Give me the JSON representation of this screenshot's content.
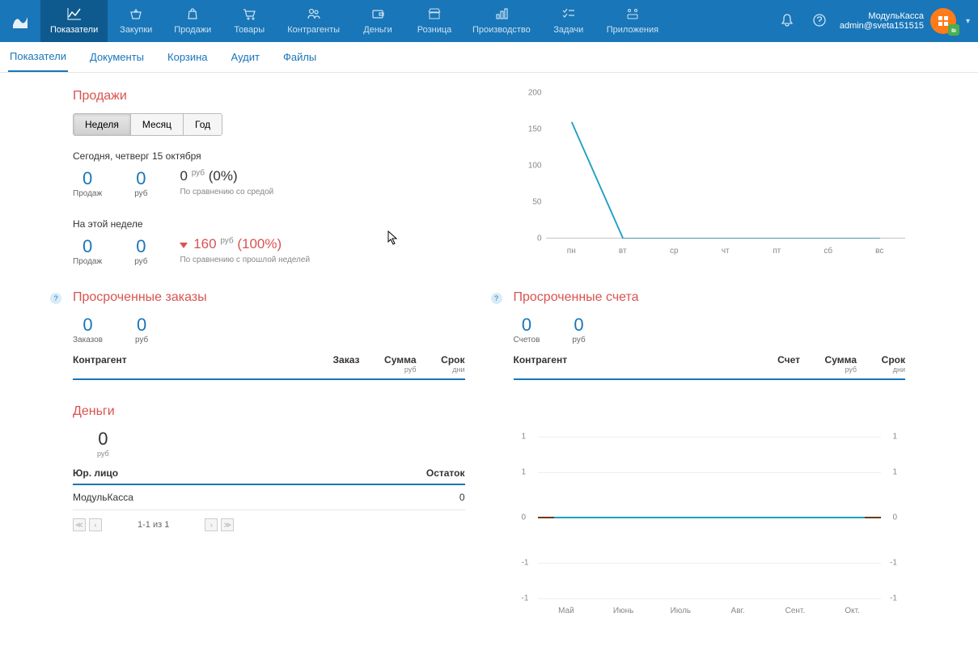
{
  "nav": {
    "items": [
      {
        "label": "Показатели"
      },
      {
        "label": "Закупки"
      },
      {
        "label": "Продажи"
      },
      {
        "label": "Товары"
      },
      {
        "label": "Контрагенты"
      },
      {
        "label": "Деньги"
      },
      {
        "label": "Розница"
      },
      {
        "label": "Производство"
      },
      {
        "label": "Задачи"
      },
      {
        "label": "Приложения"
      }
    ]
  },
  "user": {
    "title": "МодульКасса",
    "login": "admin@sveta151515"
  },
  "subnav": {
    "items": [
      {
        "label": "Показатели"
      },
      {
        "label": "Документы"
      },
      {
        "label": "Корзина"
      },
      {
        "label": "Аудит"
      },
      {
        "label": "Файлы"
      }
    ]
  },
  "sales": {
    "title": "Продажи",
    "periods": [
      {
        "label": "Неделя"
      },
      {
        "label": "Месяц"
      },
      {
        "label": "Год"
      }
    ],
    "today_label": "Сегодня, четверг 15 октября",
    "today": {
      "sales_count": "0",
      "sales_caption": "Продаж",
      "rub_value": "0",
      "rub_caption": "руб",
      "compare_value": "0",
      "compare_unit": "руб",
      "compare_pct": "(0%)",
      "compare_sub": "По сравнению со средой"
    },
    "week_label": "На этой неделе",
    "week": {
      "sales_count": "0",
      "sales_caption": "Продаж",
      "rub_value": "0",
      "rub_caption": "руб",
      "compare_value": "160",
      "compare_unit": "руб",
      "compare_pct": "(100%)",
      "compare_sub": "По сравнению с прошлой неделей"
    }
  },
  "chart_data": {
    "type": "line",
    "categories": [
      "пн",
      "вт",
      "ср",
      "чт",
      "пт",
      "сб",
      "вс"
    ],
    "values": [
      160,
      0,
      0,
      0,
      0,
      0,
      0
    ],
    "ylim": [
      0,
      200
    ],
    "yticks": [
      0,
      50,
      100,
      150,
      200
    ]
  },
  "overdue_orders": {
    "title": "Просроченные заказы",
    "orders_count": "0",
    "orders_caption": "Заказов",
    "rub_value": "0",
    "rub_caption": "руб",
    "headers": {
      "contractor": "Контрагент",
      "order": "Заказ",
      "sum": "Сумма",
      "sum_sub": "руб",
      "term": "Срок",
      "term_sub": "дни"
    }
  },
  "overdue_invoices": {
    "title": "Просроченные счета",
    "invoices_count": "0",
    "invoices_caption": "Счетов",
    "rub_value": "0",
    "rub_caption": "руб",
    "headers": {
      "contractor": "Контрагент",
      "invoice": "Счет",
      "sum": "Сумма",
      "sum_sub": "руб",
      "term": "Срок",
      "term_sub": "дни"
    }
  },
  "money": {
    "title": "Деньги",
    "value": "0",
    "caption": "руб",
    "headers": {
      "entity": "Юр. лицо",
      "balance": "Остаток"
    },
    "rows": [
      {
        "entity": "МодульКасса",
        "balance": "0"
      }
    ],
    "pagination": "1-1 из 1"
  },
  "money_chart": {
    "type": "line",
    "months": [
      "Май",
      "Июнь",
      "Июль",
      "Авг.",
      "Сент.",
      "Окт."
    ],
    "yticks": [
      -1,
      -1,
      0,
      1,
      1
    ],
    "values": [
      0,
      0,
      0,
      0,
      0,
      0
    ]
  }
}
